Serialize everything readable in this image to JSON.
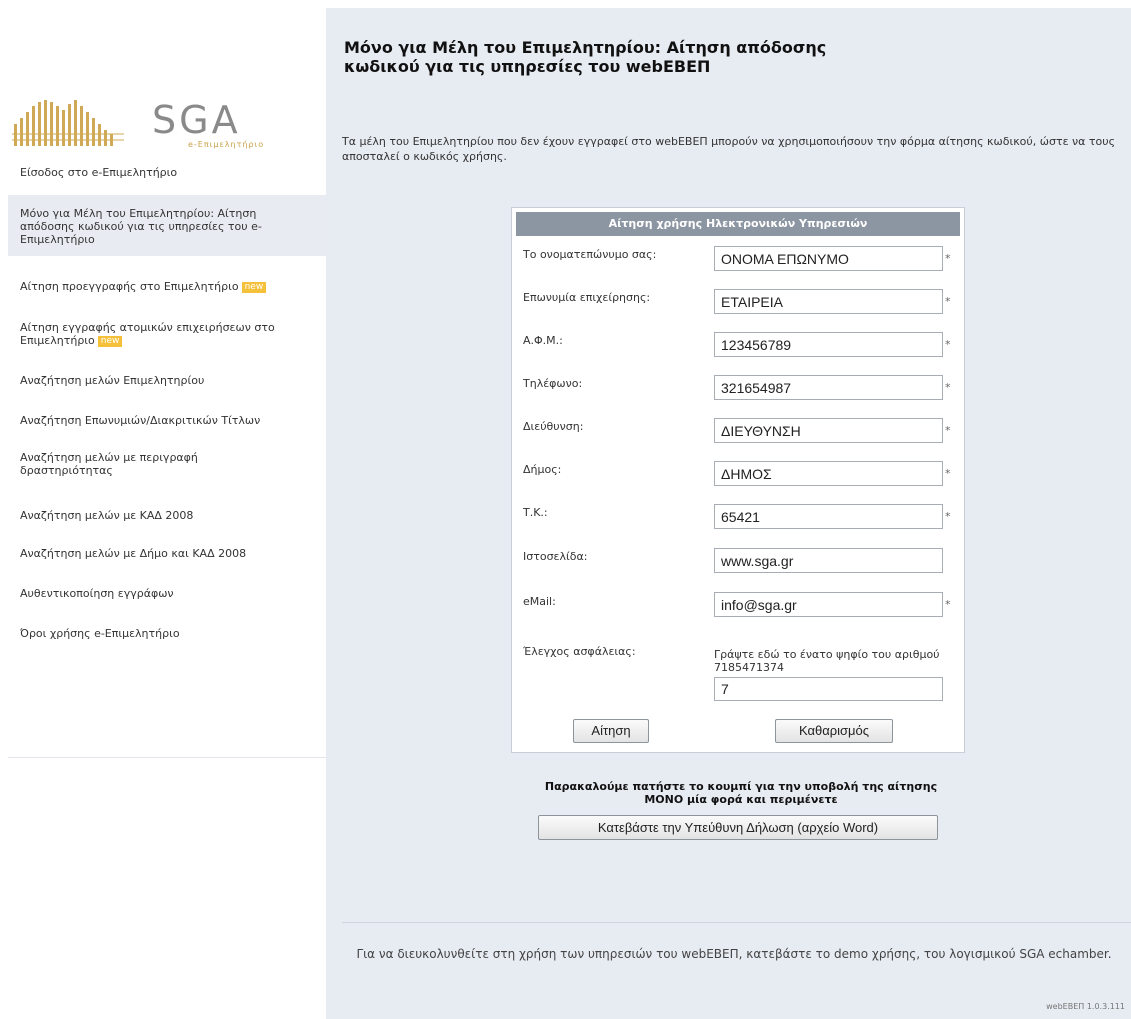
{
  "brand": {
    "logo_text": "SGA",
    "logo_subtext": "e-Επιμελητήριο"
  },
  "sidebar": {
    "items": [
      {
        "label": "Είσοδος στο e-Επιμελητήριο"
      },
      {
        "label": "Μόνο για Μέλη του Επιμελητηρίου: Αίτηση απόδοσης κωδικού για τις υπηρεσίες του e-Επιμελητήριο"
      },
      {
        "label": "Αίτηση προεγγραφής στο Επιμελητήριο",
        "badge": "new"
      },
      {
        "label": "Αίτηση εγγραφής ατομικών επιχειρήσεων στο Επιμελητήριο",
        "badge": "new"
      },
      {
        "label": "Αναζήτηση μελών Επιμελητηρίου"
      },
      {
        "label": "Αναζήτηση Επωνυμιών/Διακριτικών Τίτλων"
      },
      {
        "label": "Αναζήτηση μελών με περιγραφή δραστηριότητας"
      },
      {
        "label": "Αναζήτηση μελών με ΚΑΔ 2008"
      },
      {
        "label": "Αναζήτηση μελών με Δήμο και ΚΑΔ 2008"
      },
      {
        "label": "Αυθεντικοποίηση εγγράφων"
      },
      {
        "label": "Όροι χρήσης e-Επιμελητήριο"
      }
    ]
  },
  "main": {
    "title": "Μόνο για Μέλη του Επιμελητηρίου: Αίτηση απόδοσης κωδικού για τις υπηρεσίες του webΕΒΕΠ",
    "intro": "Τα μέλη του Επιμελητηρίου που δεν έχουν εγγραφεί στο webΕΒΕΠ μπορούν να χρησιμοποιήσουν την φόρμα αίτησης κωδικού, ώστε να τους αποσταλεί ο κωδικός χρήσης."
  },
  "form": {
    "header": "Αίτηση χρήσης Ηλεκτρονικών Υπηρεσιών",
    "required_mark": "*",
    "fields": {
      "fullname": {
        "label": "Το ονοματεπώνυμο σας:",
        "value": "ΟΝΟΜΑ ΕΠΩΝΥΜΟ"
      },
      "company": {
        "label": "Επωνυμία επιχείρησης:",
        "value": "ΕΤΑΙΡΕΙΑ"
      },
      "afm": {
        "label": "Α.Φ.Μ.:",
        "value": "123456789"
      },
      "phone": {
        "label": "Τηλέφωνο:",
        "value": "321654987"
      },
      "address": {
        "label": "Διεύθυνση:",
        "value": "ΔΙΕΥΘΥΝΣΗ"
      },
      "municipality": {
        "label": "Δήμος:",
        "value": "ΔΗΜΟΣ"
      },
      "postal": {
        "label": "Τ.Κ.:",
        "value": "65421"
      },
      "website": {
        "label": "Ιστοσελίδα:",
        "value": "www.sga.gr"
      },
      "email": {
        "label": "eMail:",
        "value": "info@sga.gr"
      },
      "captcha": {
        "label": "Έλεγχος ασφάλειας:",
        "instruction": "Γράψτε εδώ το ένατο ψηφίο του αριθμού 7185471374",
        "value": "7"
      }
    },
    "submit_label": "Αίτηση",
    "clear_label": "Καθαρισμός"
  },
  "notice": {
    "text": "Παρακαλούμε πατήστε το κουμπί για την υποβολή της αίτησης ΜΟΝΟ μία φορά και περιμένετε",
    "download_label": "Κατεβάστε την Υπεύθυνη Δήλωση (αρχείο Word)"
  },
  "footer": {
    "text": "Για να διευκολυνθείτε στη χρήση των υπηρεσιών του webΕΒΕΠ, κατεβάστε το demo χρήσης, του λογισμικού SGA echamber.",
    "version": "webΕΒΕΠ 1.0.3.111"
  },
  "colors": {
    "main_bg": "#e7ebf2",
    "form_header_bg": "#8c96a3",
    "badge_bg": "#f5c13a",
    "logo_accent": "#c9a24a",
    "logo_text": "#8a8a8a"
  }
}
